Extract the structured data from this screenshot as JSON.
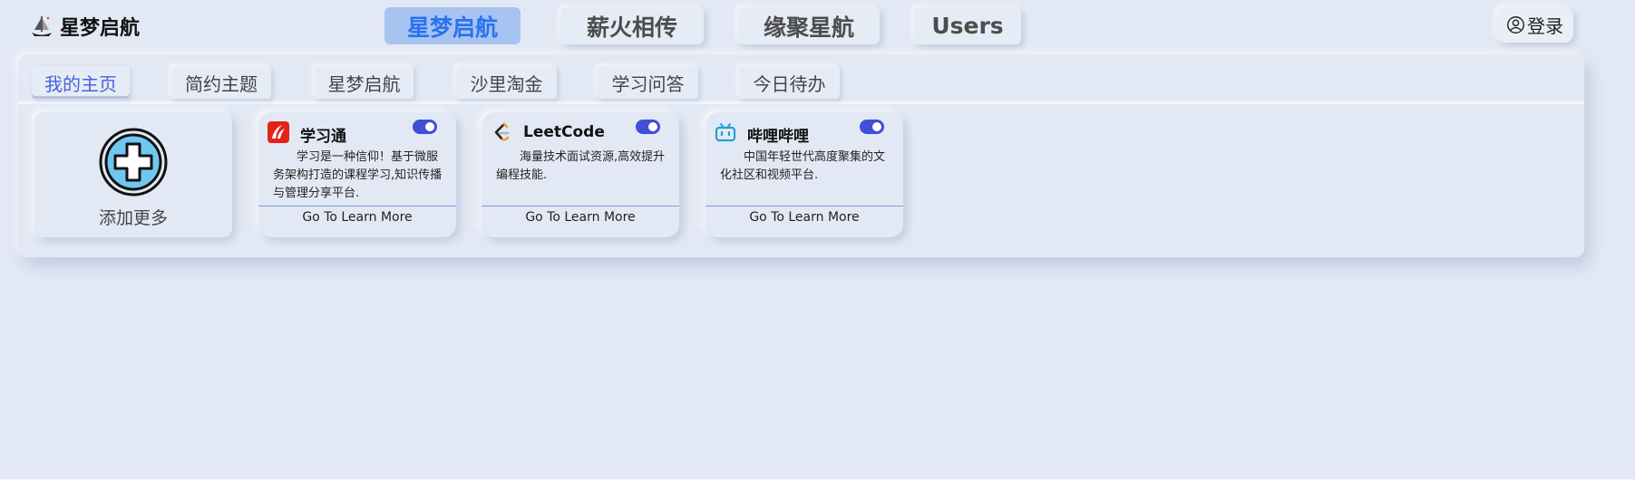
{
  "brand": {
    "name": "星梦启航",
    "logo_icon": "ship-sail-icon"
  },
  "top_nav": [
    {
      "label": "星梦启航",
      "active": true
    },
    {
      "label": "薪火相传",
      "active": false
    },
    {
      "label": "缘聚星航",
      "active": false
    },
    {
      "label": "Users",
      "active": false
    }
  ],
  "login": {
    "label": "登录",
    "icon": "user-circle-icon"
  },
  "sub_tabs": [
    {
      "label": "我的主页",
      "active": true
    },
    {
      "label": "简约主题",
      "active": false
    },
    {
      "label": "星梦启航",
      "active": false
    },
    {
      "label": "沙里淘金",
      "active": false
    },
    {
      "label": "学习问答",
      "active": false
    },
    {
      "label": "今日待办",
      "active": false
    }
  ],
  "add_card": {
    "label": "添加更多",
    "icon": "plus-circle-icon"
  },
  "cards": [
    {
      "title": "学习通",
      "icon": "xuexitong-logo-icon",
      "description": "学习是一种信仰！基于微服务架构打造的课程学习,知识传播与管理分享平台.",
      "link_label": "Go To Learn More",
      "enabled": true
    },
    {
      "title": "LeetCode",
      "icon": "leetcode-logo-icon",
      "description": "海量技术面试资源,高效提升编程技能.",
      "link_label": "Go To Learn More",
      "enabled": true
    },
    {
      "title": "哔哩哔哩",
      "icon": "bilibili-logo-icon",
      "description": "中国年轻世代高度聚集的文化社区和视频平台.",
      "link_label": "Go To Learn More",
      "enabled": true
    }
  ],
  "colors": {
    "background": "#e3e9f4",
    "active_nav_bg": "#a6c3f1",
    "active_nav_text": "#2a72ee",
    "active_subtab_text": "#4a63d6",
    "toggle_on": "#3f4fd6",
    "divider": "#7a98e8"
  }
}
